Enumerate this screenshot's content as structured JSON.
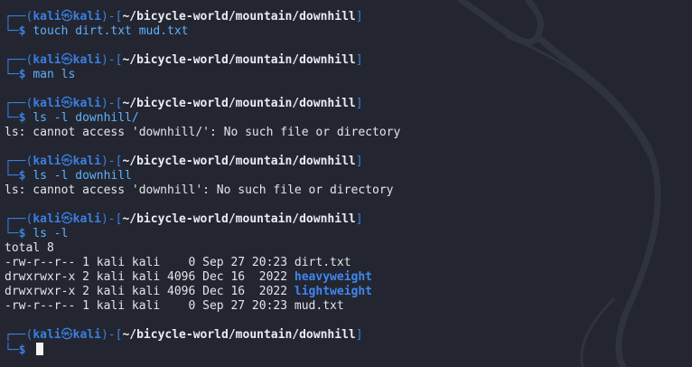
{
  "prompt": {
    "user": "kali",
    "symbol": "㉿",
    "host": "kali",
    "cwd": "~/bicycle-world/mountain/downhill"
  },
  "blocks": [
    {
      "command": "touch dirt.txt mud.txt",
      "output": []
    },
    {
      "command": "man ls",
      "output": []
    },
    {
      "command": "ls -l downhill/",
      "output": [
        "ls: cannot access 'downhill/': No such file or directory"
      ]
    },
    {
      "command": "ls -l downhill",
      "output": [
        "ls: cannot access 'downhill': No such file or directory"
      ]
    },
    {
      "command": "ls -l",
      "output": [
        "total 8"
      ],
      "listing": [
        {
          "meta": "-rw-r--r-- 1 kali kali    0 Sep 27 20:23 ",
          "name": "dirt.txt",
          "is_dir": false
        },
        {
          "meta": "drwxrwxr-x 2 kali kali 4096 Dec 16  2022 ",
          "name": "heavyweight",
          "is_dir": true
        },
        {
          "meta": "drwxrwxr-x 2 kali kali 4096 Dec 16  2022 ",
          "name": "lightweight",
          "is_dir": true
        },
        {
          "meta": "-rw-r--r-- 1 kali kali    0 Sep 27 20:23 ",
          "name": "mud.txt",
          "is_dir": false
        }
      ]
    },
    {
      "command": "",
      "output": [],
      "active": true
    }
  ],
  "colors": {
    "background": "#232630",
    "prompt_frame": "#3b7fe3",
    "command": "#5db1ff",
    "directory": "#3f86ee"
  }
}
